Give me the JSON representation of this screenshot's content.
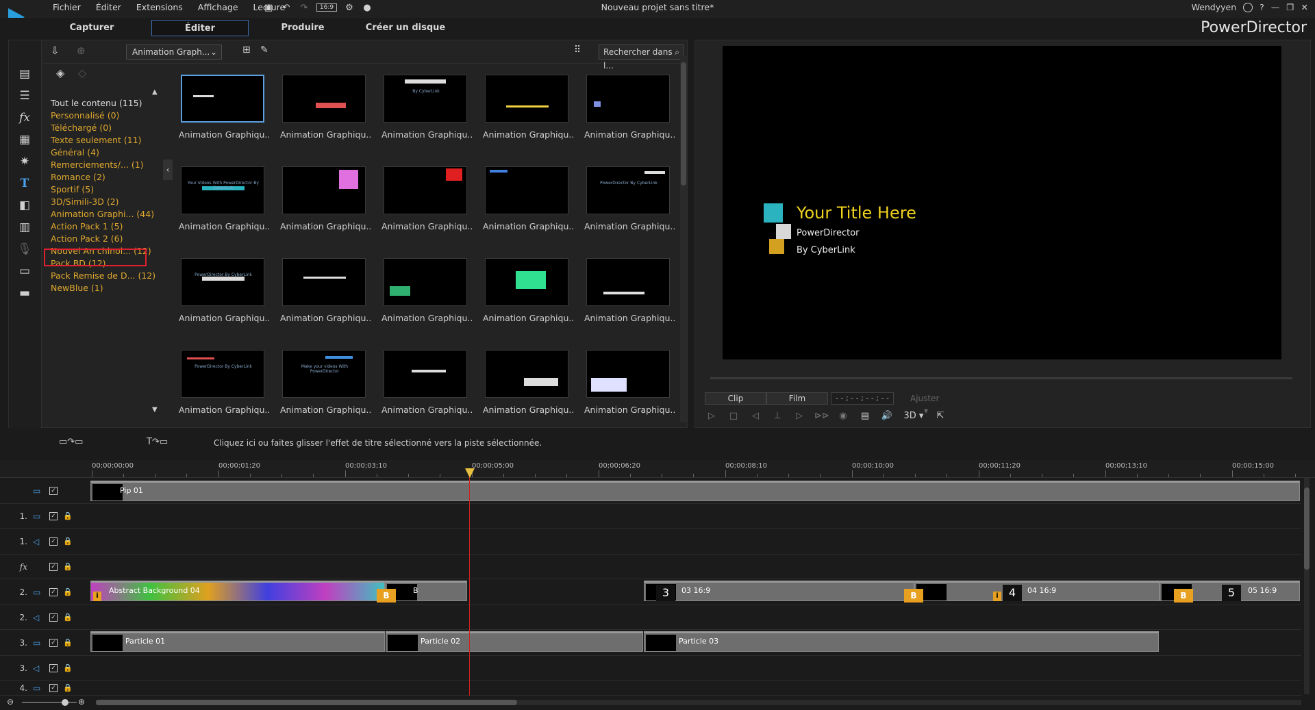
{
  "menu": [
    "Fichier",
    "Éditer",
    "Extensions",
    "Affichage",
    "Lecture"
  ],
  "toolbar": {
    "aspect": "16:9"
  },
  "project_title": "Nouveau projet sans titre*",
  "user": {
    "name": "Wendyyen",
    "help": "?"
  },
  "mode_tabs": [
    "Capturer",
    "Éditer",
    "Produire",
    "Créer un disque"
  ],
  "active_tab": "Éditer",
  "brand": "PowerDirector",
  "library": {
    "category_select": "Animation Graph...",
    "search_placeholder": "Rechercher dans l...",
    "categories": [
      {
        "label": "Tout le contenu (115)"
      },
      {
        "label": "Personnalisé  (0)"
      },
      {
        "label": "Téléchargé  (0)"
      },
      {
        "label": "Texte seulement  (11)"
      },
      {
        "label": "Général  (4)"
      },
      {
        "label": "Remerciements/...  (1)"
      },
      {
        "label": "Romance  (2)"
      },
      {
        "label": "Sportif  (5)"
      },
      {
        "label": "3D/Simili-3D  (2)"
      },
      {
        "label": "Animation Graphi...  (44)"
      },
      {
        "label": "Action Pack 1  (5)"
      },
      {
        "label": "Action Pack 2  (6)"
      },
      {
        "label": "Nouvel An chinoi...  (12)"
      },
      {
        "label": "Pack BD  (12)"
      },
      {
        "label": "Pack Remise de D...  (12)"
      },
      {
        "label": "NewBlue  (1)"
      }
    ],
    "thumb_caption": "Animation Graphiqu...",
    "thumb_texts": [
      "",
      "",
      "By CyberLink",
      "",
      "",
      "Your Videos With PowerDirector By CyberLink",
      "",
      "",
      "",
      "PowerDirector By CyberLink",
      "PowerDirector By CyberLink",
      "",
      "",
      "",
      "",
      "PowerDirector By CyberLink",
      "Make your videos With PowerDirector",
      "",
      "",
      ""
    ]
  },
  "preview": {
    "title": "Your Title Here",
    "line1": "PowerDirector",
    "line2": "By CyberLink",
    "clip_label": "Clip",
    "film_label": "Film",
    "timecode": "- - ; - - ; - - ; - -",
    "fit_label": "Ajuster",
    "mode_3d": "3D"
  },
  "timeline": {
    "hint": "Cliquez ici ou faites glisser l'effet de titre sélectionné vers la piste sélectionnée.",
    "ruler": [
      "00;00;00;00",
      "00;00;01;20",
      "00;00;03;10",
      "00;00;05;00",
      "00;00;06;20",
      "00;00;08;10",
      "00;00;10;00",
      "00;00;11;20",
      "00;00;13;10",
      "00;00;15;00"
    ],
    "tracks": [
      {
        "label": ""
      },
      {
        "label": "1."
      },
      {
        "label": "1."
      },
      {
        "label": "fx"
      },
      {
        "label": "2."
      },
      {
        "label": "2."
      },
      {
        "label": "3."
      },
      {
        "label": "3."
      },
      {
        "label": "4."
      }
    ],
    "clips": {
      "pip": "Pip 01",
      "abstract": "Abstract Background 04",
      "t3": "3",
      "t3_label": "03 16:9",
      "t4": "4",
      "t4_label": "04 16:9",
      "t5": "5",
      "t5_label": "05 16:9",
      "p1": "Particle 01",
      "p2": "Particle 02",
      "p3": "Particle 03",
      "b": "B",
      "i": "i"
    }
  },
  "colors": {
    "accent": "#3d6fa8",
    "category": "#e0a92e",
    "highlight": "#e0202e",
    "title_yellow": "#f0d21e"
  }
}
